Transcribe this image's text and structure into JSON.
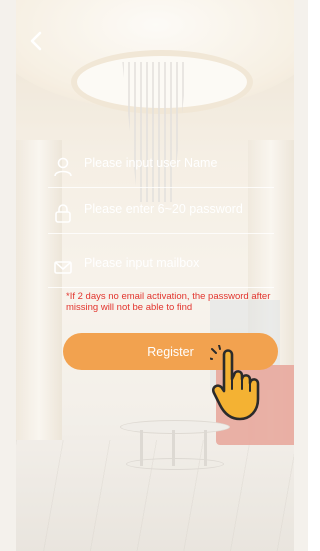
{
  "nav": {
    "back_icon": "chevron-left-icon"
  },
  "form": {
    "user_field": {
      "placeholder": "Please input user Name",
      "icon": "user-icon"
    },
    "password_field": {
      "placeholder": "Please enter 6~20 password",
      "icon": "lock-icon"
    },
    "email_field": {
      "placeholder": "Please input mailbox",
      "icon": "mail-icon"
    },
    "warning": "*If 2 days no email activation, the password after missing will not be able to find",
    "register_label": "Register"
  },
  "overlay": {
    "pointer_icon": "tap-hand-icon"
  },
  "colors": {
    "accent": "#f2a24f",
    "warning": "#e2352e"
  }
}
